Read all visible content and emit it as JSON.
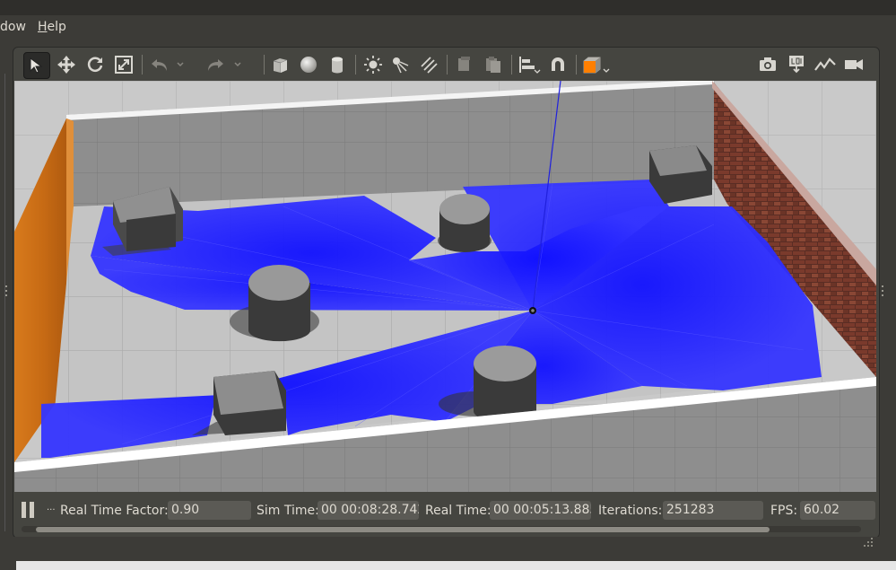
{
  "menubar": {
    "items": [
      {
        "label": "dow",
        "underline": "",
        "rest": "dow"
      },
      {
        "label": "Help",
        "underline": "H",
        "rest": "elp"
      }
    ]
  },
  "toolbar": {
    "buttons": [
      {
        "name": "select-mode-button",
        "icon": "arrow-cursor-icon"
      },
      {
        "name": "translate-mode-button",
        "icon": "move-arrows-icon"
      },
      {
        "name": "rotate-mode-button",
        "icon": "rotate-icon"
      },
      {
        "name": "scale-mode-button",
        "icon": "scale-icon"
      },
      {
        "name": "undo-button",
        "icon": "undo-icon"
      },
      {
        "name": "redo-button",
        "icon": "redo-icon"
      },
      {
        "name": "box-shape-button",
        "icon": "box-icon"
      },
      {
        "name": "sphere-shape-button",
        "icon": "sphere-icon"
      },
      {
        "name": "cylinder-shape-button",
        "icon": "cylinder-icon"
      },
      {
        "name": "point-light-button",
        "icon": "sun-icon"
      },
      {
        "name": "spot-light-button",
        "icon": "spot-light-icon"
      },
      {
        "name": "directional-light-button",
        "icon": "directional-light-icon"
      },
      {
        "name": "copy-button",
        "icon": "copy-icon"
      },
      {
        "name": "paste-button",
        "icon": "paste-icon"
      },
      {
        "name": "align-button",
        "icon": "align-icon"
      },
      {
        "name": "snap-button",
        "icon": "magnet-icon"
      },
      {
        "name": "view-angle-button",
        "icon": "orange-cube-icon"
      },
      {
        "name": "screenshot-button",
        "icon": "camera-icon"
      },
      {
        "name": "log-button",
        "icon": "log-icon"
      },
      {
        "name": "plot-button",
        "icon": "chart-icon"
      },
      {
        "name": "record-video-button",
        "icon": "video-camera-icon"
      }
    ]
  },
  "statusbar": {
    "real_time_factor_label": "Real Time Factor:",
    "real_time_factor_value": "0.90",
    "sim_time_label": "Sim Time:",
    "sim_time_value": "00 00:08:28.742",
    "real_time_label": "Real Time:",
    "real_time_value": "00 00:05:13.885",
    "iterations_label": "Iterations:",
    "iterations_value": "251283",
    "fps_label": "FPS:",
    "fps_value": "60.02",
    "step_indicator": "..."
  },
  "colors": {
    "laser_blue": "#2222ff",
    "accent_orange": "#ff7f00",
    "panel_bg": "#3c3b37"
  }
}
